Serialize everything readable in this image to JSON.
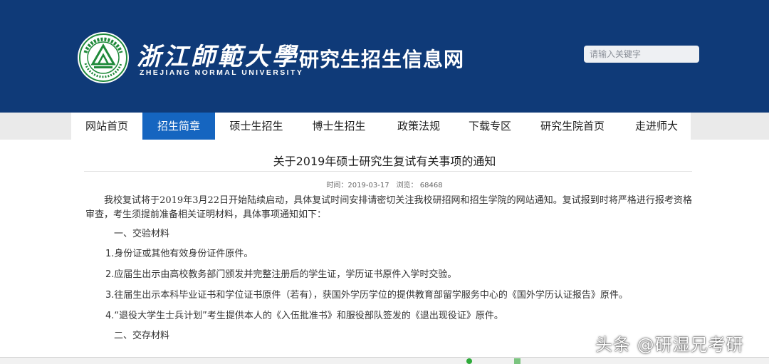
{
  "header": {
    "logo_cn": "浙江師範大學",
    "logo_en": "ZHEJIANG NORMAL UNIVERSITY",
    "site_title": "研究生招生信息网",
    "search_placeholder": "请输入关键字"
  },
  "nav": {
    "items": [
      {
        "label": "网站首页",
        "active": false
      },
      {
        "label": "招生简章",
        "active": true
      },
      {
        "label": "硕士生招生",
        "active": false
      },
      {
        "label": "博士生招生",
        "active": false
      },
      {
        "label": "政策法规",
        "active": false
      },
      {
        "label": "下载专区",
        "active": false
      },
      {
        "label": "研究生院首页",
        "active": false
      },
      {
        "label": "走进师大",
        "active": false
      }
    ]
  },
  "article": {
    "title": "关于2019年硕士研究生复试有关事项的通知",
    "time": "时间：2019-03-17",
    "views": "浏览：  68468",
    "intro": "我校复试将于2019年3月22日开始陆续启动，具体复试时间安排请密切关注我校研招网和招生学院的网站通知。复试报到时将严格进行报考资格审查，考生须提前准备相关证明材料，具体事项通知如下：",
    "section1": "一、交验材料",
    "items": [
      "1.身份证或其他有效身份证件原件。",
      "2.应届生出示由高校教务部门颁发并完整注册后的学生证，学历证书原件入学时交验。",
      "3.往届生出示本科毕业证书和学位证书原件（若有），获国外学历学位的提供教育部留学服务中心的《国外学历认证报告》原件。",
      "4.“退役大学生士兵计划”考生提供本人的《入伍批准书》和服役部队签发的《退出现役证》原件。"
    ],
    "section2": "二、交存材料"
  },
  "watermark": "头条 @研湿兄考研",
  "colors": {
    "header_bg": "#0f3a78",
    "nav_active": "#1565c0",
    "seal_green": "#1f8a3a"
  }
}
